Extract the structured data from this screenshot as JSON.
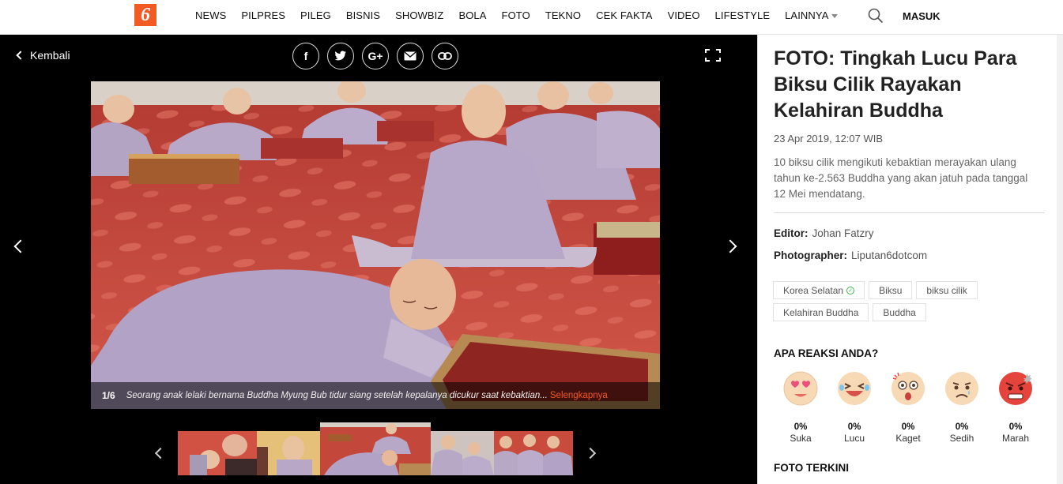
{
  "nav": {
    "logo": "6",
    "items": [
      "NEWS",
      "PILPRES",
      "PILEG",
      "BISNIS",
      "SHOWBIZ",
      "BOLA",
      "FOTO",
      "TEKNO",
      "CEK FAKTA",
      "VIDEO",
      "LIFESTYLE",
      "LAINNYA"
    ],
    "login": "MASUK"
  },
  "gallery": {
    "back_label": "Kembali",
    "share_buttons": [
      "facebook-icon",
      "twitter-icon",
      "google-plus-icon",
      "email-icon",
      "link-icon"
    ],
    "counter": "1/6",
    "caption": "Seorang anak lelaki bernama Buddha Myung Bub tidur siang setelah kepalanya dicukur saat kebaktian...",
    "more_label": "Selengkapnya"
  },
  "article": {
    "title": "FOTO: Tingkah Lucu Para Biksu Cilik Rayakan Kelahiran Buddha",
    "date": "23 Apr 2019, 12:07 WIB",
    "description": "10 biksu cilik mengikuti kebaktian merayakan ulang tahun ke-2.563 Buddha yang akan jatuh pada tanggal 12 Mei mendatang.",
    "editor_label": "Editor:",
    "editor": "Johan Fatzry",
    "photographer_label": "Photographer:",
    "photographer": "Liputan6dotcom",
    "tags": [
      "Korea Selatan",
      "Biksu",
      "biksu cilik",
      "Kelahiran Buddha",
      "Buddha"
    ]
  },
  "reactions": {
    "title": "APA REAKSI ANDA?",
    "items": [
      {
        "label": "Suka",
        "percent": "0%"
      },
      {
        "label": "Lucu",
        "percent": "0%"
      },
      {
        "label": "Kaget",
        "percent": "0%"
      },
      {
        "label": "Sedih",
        "percent": "0%"
      },
      {
        "label": "Marah",
        "percent": "0%"
      }
    ]
  },
  "latest_title": "FOTO TERKINI",
  "colors": {
    "brand": "#f15a22",
    "gallery_bg": "#000000",
    "floor": "#c8473c",
    "robe": "#b6a6c6"
  }
}
